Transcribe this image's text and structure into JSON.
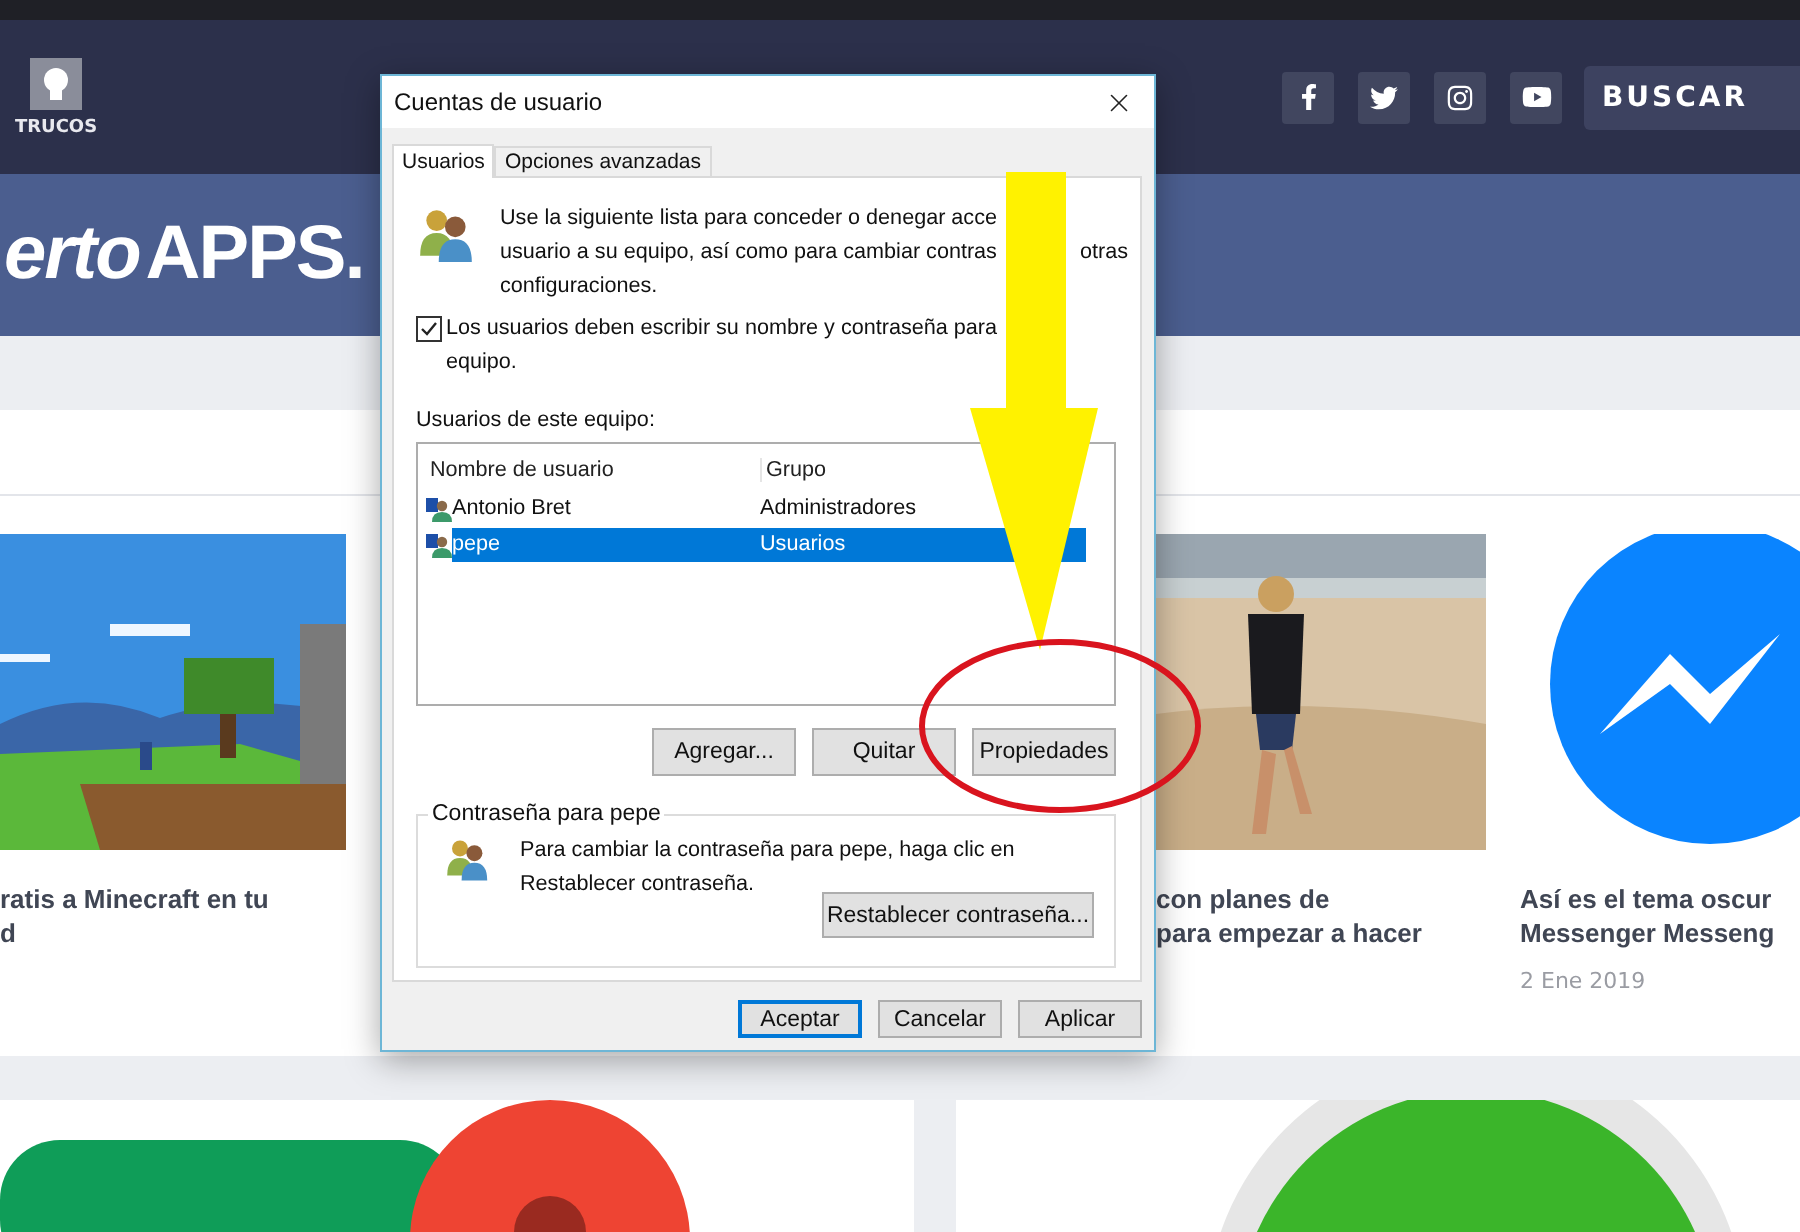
{
  "site": {
    "nav_label": "TRUCOS",
    "search": "BUSCAR",
    "logo": [
      "erto",
      "APPS."
    ],
    "articles": [
      {
        "title_lines": [
          "ratis a Minecraft en tu",
          "d"
        ]
      },
      {
        "title_lines": [
          "con planes de",
          "para empezar a hacer"
        ]
      },
      {
        "title_lines": [
          "Así es el tema oscur",
          "Messenger Messeng"
        ],
        "date": "2 Ene 2019"
      }
    ]
  },
  "dialog": {
    "title": "Cuentas de usuario",
    "tabs": [
      {
        "label": "Usuarios",
        "selected": true
      },
      {
        "label": "Opciones avanzadas",
        "selected": false
      }
    ],
    "intro_lines": [
      "Use la siguiente lista para conceder o denegar acce",
      "usuario a su equipo, así como para cambiar contras",
      "otras",
      "configuraciones."
    ],
    "require_password": {
      "checked": true,
      "lines": [
        "Los usuarios deben escribir su nombre y contraseña para",
        "equipo."
      ]
    },
    "list_label": "Usuarios de este equipo:",
    "columns": [
      "Nombre de usuario",
      "Grupo"
    ],
    "users": [
      {
        "name": "Antonio Bret",
        "group": "Administradores",
        "selected": false
      },
      {
        "name": "pepe",
        "group": "Usuarios",
        "selected": true
      }
    ],
    "buttons": [
      "Agregar...",
      "Quitar",
      "Propiedades"
    ],
    "password_group": {
      "legend": "Contraseña para pepe",
      "lines": [
        "Para cambiar la contraseña para pepe, haga clic en",
        "Restablecer contraseña."
      ],
      "button": "Restablecer contraseña..."
    },
    "footer_buttons": [
      {
        "label": "Aceptar",
        "default": true
      },
      {
        "label": "Cancelar",
        "default": false
      },
      {
        "label": "Aplicar",
        "default": false
      }
    ]
  }
}
